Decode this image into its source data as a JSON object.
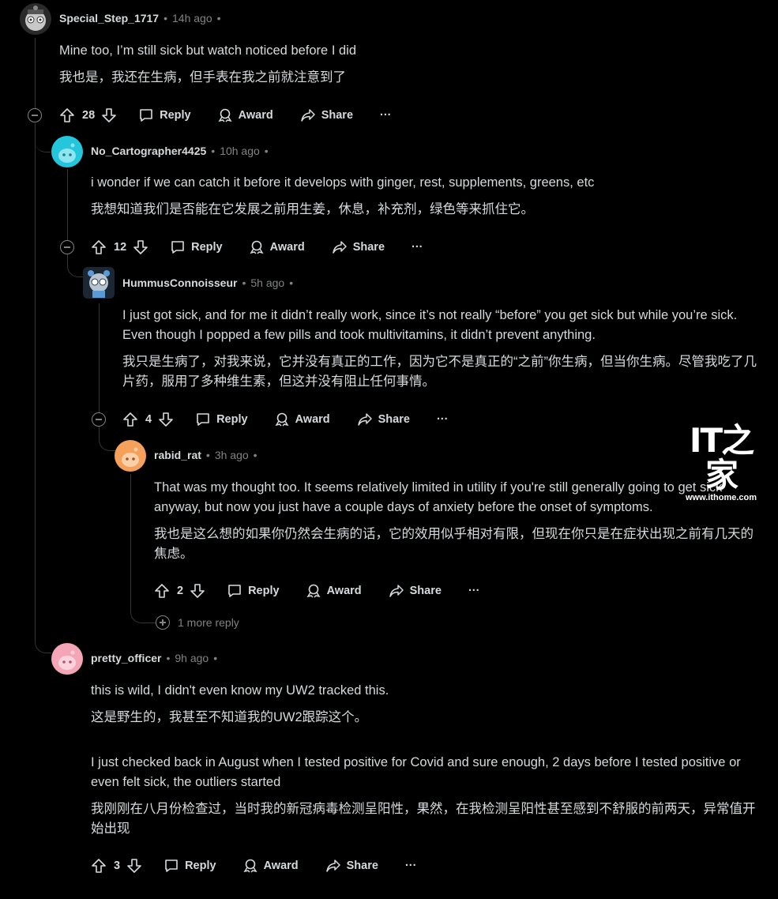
{
  "comments": [
    {
      "author": "Special_Step_1717",
      "time": "14h ago",
      "body_en": "Mine too, I’m still sick but watch noticed before I did",
      "body_zh": "我也是，我还在生病，但手表在我之前就注意到了",
      "votes": "28",
      "avatar_color": "#c8c8c8"
    },
    {
      "author": "No_Cartographer4425",
      "time": "10h ago",
      "body_en": "i wonder if we can catch it before it develops with ginger, rest, supplements, greens, etc",
      "body_zh": "我想知道我们是否能在它发展之前用生姜，休息，补充剂，绿色等来抓住它。",
      "votes": "12",
      "avatar_color": "#24c6dc"
    },
    {
      "author": "HummusConnoisseur",
      "time": "5h ago",
      "body_en": "I just got sick, and for me it didn’t really work, since it’s not really “before” you get sick but while you’re sick. Even though I popped a few pills and took multivitamins, it didn’t prevent anything.",
      "body_zh": "我只是生病了，对我来说，它并没有真正的工作，因为它不是真正的“之前”你生病，但当你生病。尽管我吃了几片药，服用了多种维生素，但这并没有阻止任何事情。",
      "votes": "4",
      "avatar_color": "#5b9bd5"
    },
    {
      "author": "rabid_rat",
      "time": "3h ago",
      "body_en": "That was my thought too. It seems relatively limited in utility if you're still generally going to get sick anyway, but now you just have a couple days of anxiety before the onset of symptoms.",
      "body_zh": "我也是这么想的如果你仍然会生病的话，它的效用似乎相对有限，但现在你只是在症状出现之前有几天的焦虑。",
      "votes": "2",
      "avatar_color": "#f5a15c"
    },
    {
      "author": "pretty_officer",
      "time": "9h ago",
      "body_en": "this is wild, I didn't even know my UW2 tracked this.",
      "body_zh": "这是野生的，我甚至不知道我的UW2跟踪这个。",
      "body_en2": "I just checked back in August when I tested positive for Covid and sure enough, 2 days before I tested positive or even felt sick, the outliers started",
      "body_zh2": "我刚刚在八月份检查过，当时我的新冠病毒检测呈阳性，果然，在我检测呈阳性甚至感到不舒服的前两天，异常值开始出现",
      "votes": "3",
      "avatar_color": "#f4a5b6"
    }
  ],
  "labels": {
    "reply": "Reply",
    "award": "Award",
    "share": "Share",
    "more": "···",
    "dot": "•",
    "more_replies": "1 more reply"
  },
  "watermark": {
    "logo": "IT之家",
    "url": "www.ithome.com"
  }
}
